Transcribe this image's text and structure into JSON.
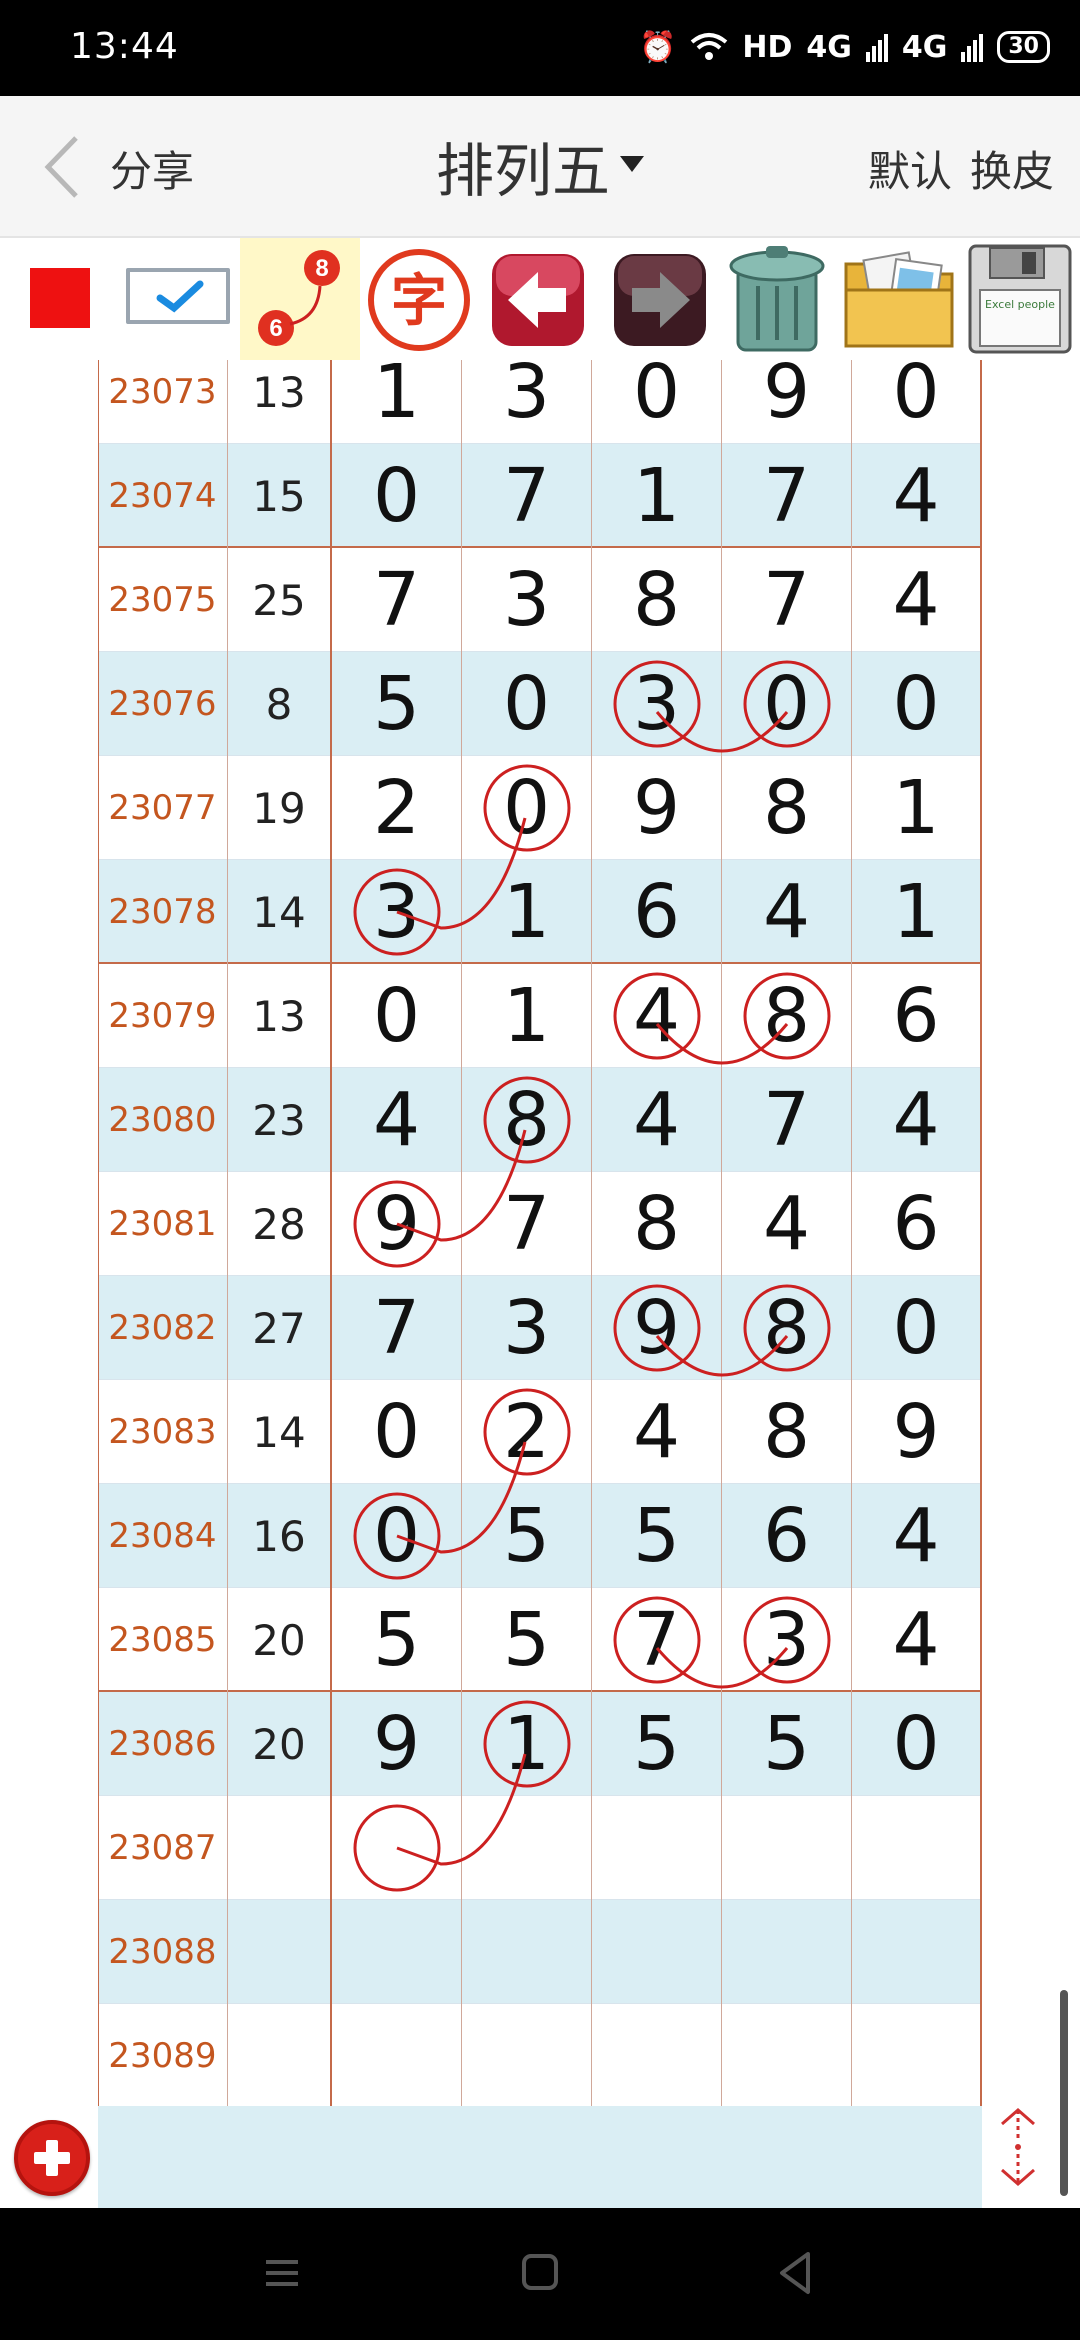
{
  "status_bar": {
    "time": "13:44",
    "network": "HD",
    "signal1": "4G",
    "signal2": "4G",
    "battery": "30"
  },
  "header": {
    "back_label": "",
    "share_label": "分享",
    "title": "排列五",
    "default_label": "默认",
    "skin_label": "换皮"
  },
  "toolbar": {
    "line_tool": {
      "from_digit": "6",
      "to_digit": "8"
    },
    "text_tool_label": "字",
    "note_label": "Excel people",
    "colors": {
      "red": "#ee1111",
      "accent": "#c4561f",
      "row_alt": "#daeef4",
      "circle": "#cc2020"
    }
  },
  "rows": [
    {
      "issue": "23073",
      "sum": "13",
      "digits": [
        "1",
        "3",
        "0",
        "9",
        "0"
      ]
    },
    {
      "issue": "23074",
      "sum": "15",
      "digits": [
        "0",
        "7",
        "1",
        "7",
        "4"
      ]
    },
    {
      "issue": "23075",
      "sum": "25",
      "digits": [
        "7",
        "3",
        "8",
        "7",
        "4"
      ]
    },
    {
      "issue": "23076",
      "sum": "8",
      "digits": [
        "5",
        "0",
        "3",
        "0",
        "0"
      ]
    },
    {
      "issue": "23077",
      "sum": "19",
      "digits": [
        "2",
        "0",
        "9",
        "8",
        "1"
      ]
    },
    {
      "issue": "23078",
      "sum": "14",
      "digits": [
        "3",
        "1",
        "6",
        "4",
        "1"
      ]
    },
    {
      "issue": "23079",
      "sum": "13",
      "digits": [
        "0",
        "1",
        "4",
        "8",
        "6"
      ]
    },
    {
      "issue": "23080",
      "sum": "23",
      "digits": [
        "4",
        "8",
        "4",
        "7",
        "4"
      ]
    },
    {
      "issue": "23081",
      "sum": "28",
      "digits": [
        "9",
        "7",
        "8",
        "4",
        "6"
      ]
    },
    {
      "issue": "23082",
      "sum": "27",
      "digits": [
        "7",
        "3",
        "9",
        "8",
        "0"
      ]
    },
    {
      "issue": "23083",
      "sum": "14",
      "digits": [
        "0",
        "2",
        "4",
        "8",
        "9"
      ]
    },
    {
      "issue": "23084",
      "sum": "16",
      "digits": [
        "0",
        "5",
        "5",
        "6",
        "4"
      ]
    },
    {
      "issue": "23085",
      "sum": "20",
      "digits": [
        "5",
        "5",
        "7",
        "3",
        "4"
      ]
    },
    {
      "issue": "23086",
      "sum": "20",
      "digits": [
        "9",
        "1",
        "5",
        "5",
        "0"
      ]
    },
    {
      "issue": "23087",
      "sum": "",
      "digits": [
        "",
        "",
        "",
        "",
        ""
      ]
    },
    {
      "issue": "23088",
      "sum": "",
      "digits": [
        "",
        "",
        "",
        "",
        ""
      ]
    },
    {
      "issue": "23089",
      "sum": "",
      "digits": [
        "",
        "",
        "",
        "",
        ""
      ]
    }
  ],
  "annotations": {
    "circles": [
      {
        "row": 3,
        "col": 2
      },
      {
        "row": 3,
        "col": 3
      },
      {
        "row": 4,
        "col": 1
      },
      {
        "row": 5,
        "col": 0
      },
      {
        "row": 6,
        "col": 2
      },
      {
        "row": 6,
        "col": 3
      },
      {
        "row": 7,
        "col": 1
      },
      {
        "row": 8,
        "col": 0
      },
      {
        "row": 9,
        "col": 2
      },
      {
        "row": 9,
        "col": 3
      },
      {
        "row": 10,
        "col": 1
      },
      {
        "row": 11,
        "col": 0
      },
      {
        "row": 12,
        "col": 2
      },
      {
        "row": 12,
        "col": 3
      },
      {
        "row": 13,
        "col": 1
      },
      {
        "row": 14,
        "col": 0
      }
    ],
    "links": [
      {
        "from": [
          3,
          2
        ],
        "to": [
          3,
          3
        ],
        "kind": "smile"
      },
      {
        "from": [
          4,
          1
        ],
        "to": [
          5,
          0
        ],
        "kind": "diag"
      },
      {
        "from": [
          6,
          2
        ],
        "to": [
          6,
          3
        ],
        "kind": "smile"
      },
      {
        "from": [
          7,
          1
        ],
        "to": [
          8,
          0
        ],
        "kind": "diag"
      },
      {
        "from": [
          9,
          2
        ],
        "to": [
          9,
          3
        ],
        "kind": "smile"
      },
      {
        "from": [
          10,
          1
        ],
        "to": [
          11,
          0
        ],
        "kind": "diag"
      },
      {
        "from": [
          12,
          2
        ],
        "to": [
          12,
          3
        ],
        "kind": "smile"
      },
      {
        "from": [
          13,
          1
        ],
        "to": [
          14,
          0
        ],
        "kind": "diag"
      }
    ]
  }
}
